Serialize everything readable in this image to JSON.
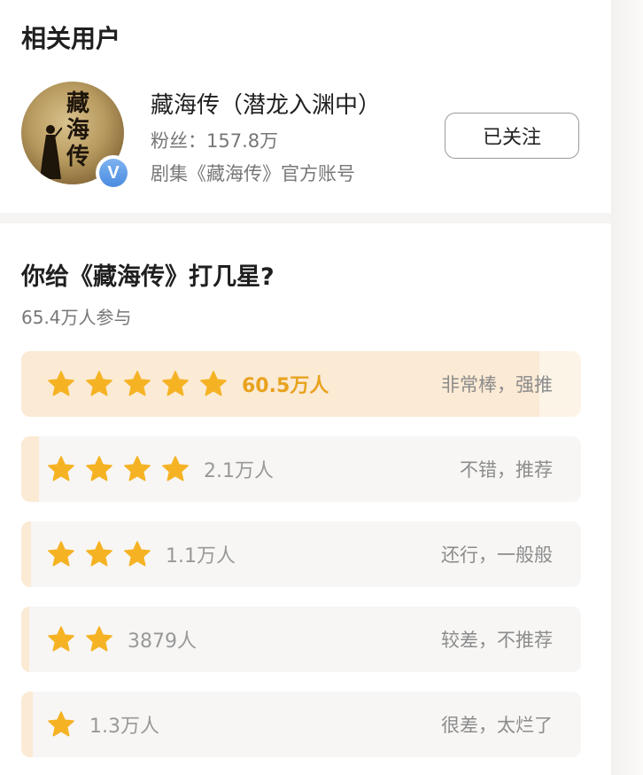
{
  "related": {
    "section_title": "相关用户",
    "avatar_text": "藏海传",
    "name": "藏海传（潜龙入渊中）",
    "fans": "粉丝：157.8万",
    "description": "剧集《藏海传》官方账号",
    "follow_label": "已关注",
    "verified_badge": "V"
  },
  "rating": {
    "title": "你给《藏海传》打几星?",
    "participants": "65.4万人参与",
    "rows": [
      {
        "stars": 5,
        "count": "60.5万人",
        "label": "非常棒，强推",
        "share": 0.925
      },
      {
        "stars": 4,
        "count": "2.1万人",
        "label": "不错，推荐",
        "share": 0.032
      },
      {
        "stars": 3,
        "count": "1.1万人",
        "label": "还行，一般般",
        "share": 0.017
      },
      {
        "stars": 2,
        "count": "3879人",
        "label": "较差，不推荐",
        "share": 0.006
      },
      {
        "stars": 1,
        "count": "1.3万人",
        "label": "很差，太烂了",
        "share": 0.02
      }
    ]
  },
  "colors": {
    "star": "#f5b324",
    "highlight_text": "#e8a21e",
    "highlight_fill": "#fbead4"
  }
}
